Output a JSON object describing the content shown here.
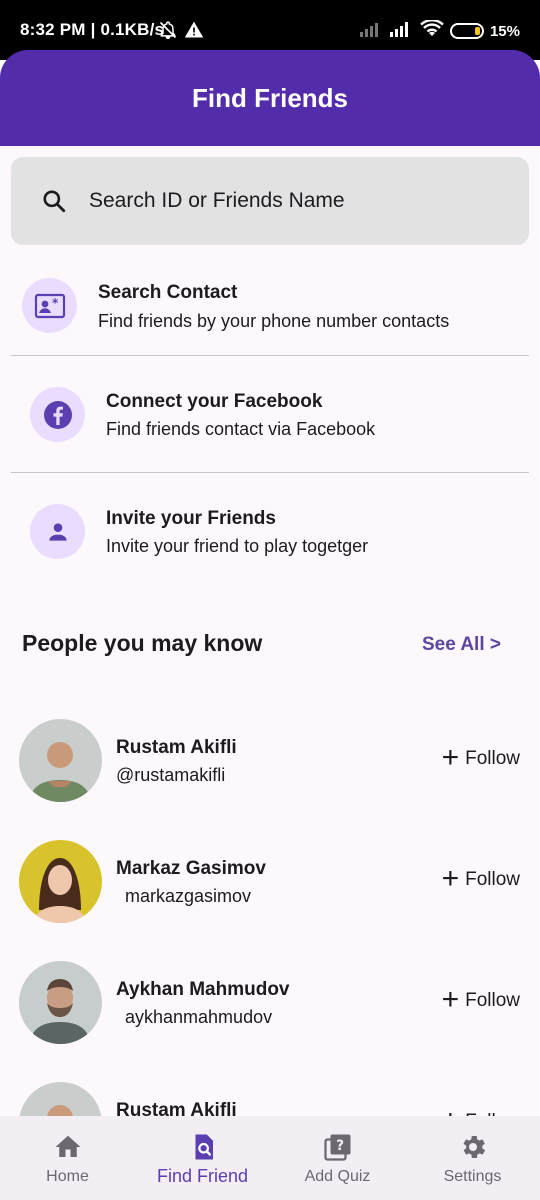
{
  "status_bar": {
    "time_text": "8:32 PM | 0.1KB/s",
    "battery": "15%"
  },
  "app_bar": {
    "title": "Find Friends"
  },
  "search": {
    "placeholder": "Search ID or Friends Name",
    "icon": "search-icon"
  },
  "options": [
    {
      "title": "Search Contact",
      "subtitle": "Find friends by your phone number contacts",
      "icon": "contact-card-icon"
    },
    {
      "title": "Connect your Facebook",
      "subtitle": "Find friends contact via Facebook",
      "icon": "facebook-icon"
    },
    {
      "title": "Invite your Friends",
      "subtitle": "Invite your friend to play togetger",
      "icon": "person-icon"
    }
  ],
  "people_section": {
    "title": "People you may know",
    "see_all": "See All >"
  },
  "people": [
    {
      "name": "Rustam Akifli",
      "handle": "@rustamakifli",
      "follow": "Follow"
    },
    {
      "name": "Markaz Gasimov",
      "handle": "markazgasimov",
      "follow": "Follow"
    },
    {
      "name": "Aykhan Mahmudov",
      "handle": "aykhanmahmudov",
      "follow": "Follow"
    },
    {
      "name": "Rustam Akifli",
      "handle": "",
      "follow": "Follow"
    }
  ],
  "bottom_nav": [
    {
      "label": "Home",
      "icon": "home-icon",
      "active": false
    },
    {
      "label": "Find Friend",
      "icon": "find-friend-icon",
      "active": true
    },
    {
      "label": "Add Quiz",
      "icon": "quiz-icon",
      "active": false
    },
    {
      "label": "Settings",
      "icon": "gear-icon",
      "active": false
    }
  ],
  "colors": {
    "primary": "#522cab",
    "accent_light": "#eadcff",
    "accent_text": "#5b47a0",
    "background": "#fcf8fc"
  }
}
